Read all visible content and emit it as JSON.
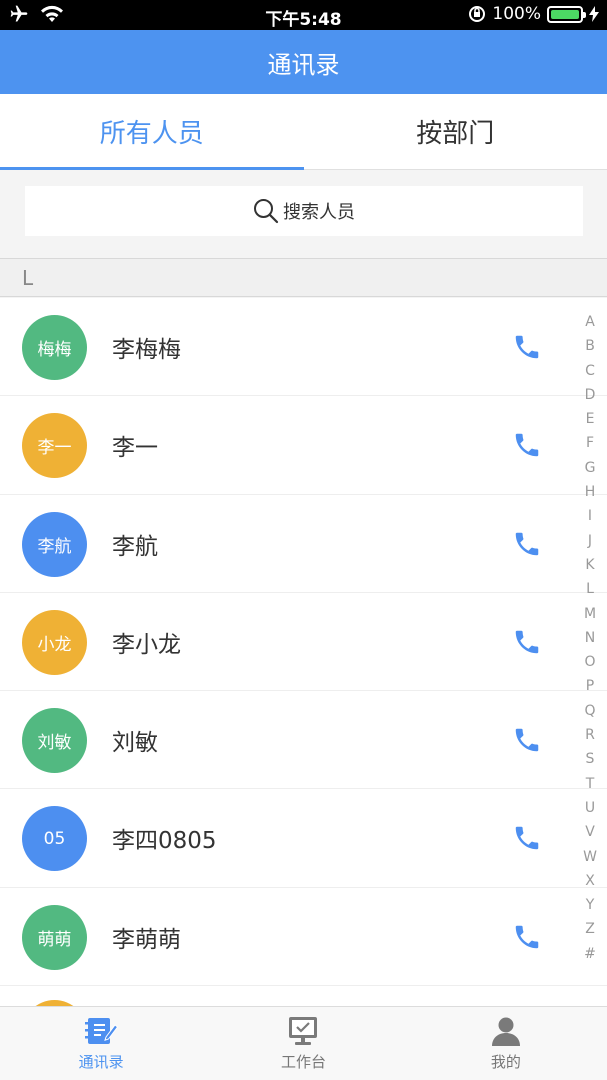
{
  "status_bar": {
    "time": "下午5:48",
    "battery_text": "100%",
    "battery_color": "#4cd964"
  },
  "nav": {
    "title": "通讯录"
  },
  "tabs": [
    {
      "label": "所有人员",
      "active": true
    },
    {
      "label": "按部门",
      "active": false
    }
  ],
  "search": {
    "placeholder": "搜索人员"
  },
  "section": {
    "letter": "L"
  },
  "contacts": [
    {
      "avatar": "梅梅",
      "name": "李梅梅",
      "color": "#52b981"
    },
    {
      "avatar": "李一",
      "name": "李一",
      "color": "#efb135"
    },
    {
      "avatar": "李航",
      "name": "李航",
      "color": "#4d8ff0"
    },
    {
      "avatar": "小龙",
      "name": "李小龙",
      "color": "#efb135"
    },
    {
      "avatar": "刘敏",
      "name": "刘敏",
      "color": "#52b981"
    },
    {
      "avatar": "05",
      "name": "李四0805",
      "color": "#4d8ff0"
    },
    {
      "avatar": "萌萌",
      "name": "李萌萌",
      "color": "#52b981"
    }
  ],
  "index_letters": [
    "A",
    "B",
    "C",
    "D",
    "E",
    "F",
    "G",
    "H",
    "I",
    "J",
    "K",
    "L",
    "M",
    "N",
    "O",
    "P",
    "Q",
    "R",
    "S",
    "T",
    "U",
    "V",
    "W",
    "X",
    "Y",
    "Z",
    "#"
  ],
  "tabbar": [
    {
      "label": "通讯录",
      "icon": "contacts-icon",
      "active": true
    },
    {
      "label": "工作台",
      "icon": "workbench-icon",
      "active": false
    },
    {
      "label": "我的",
      "icon": "profile-icon",
      "active": false
    }
  ],
  "colors": {
    "accent": "#4d93f0"
  }
}
